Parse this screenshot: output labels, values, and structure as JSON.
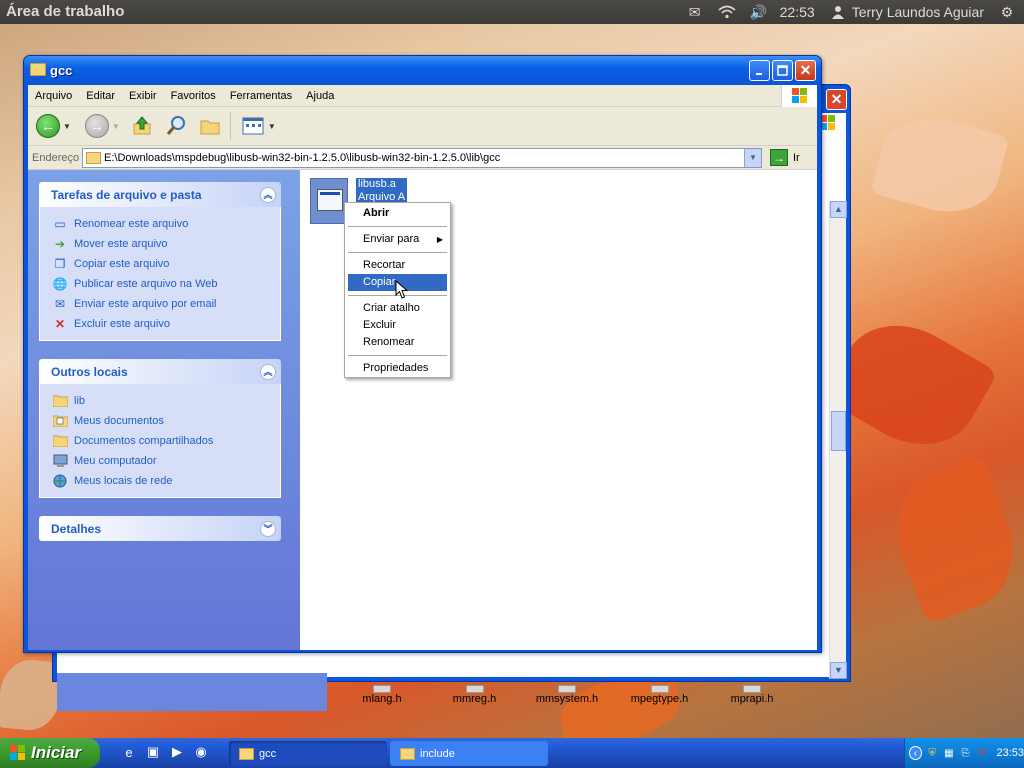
{
  "top_panel": {
    "title": "Área de trabalho",
    "time": "22:53",
    "user": "Terry Laundos Aguiar",
    "icons": [
      "mail-icon",
      "wifi-icon",
      "volume-icon",
      "user-icon",
      "settings-icon"
    ]
  },
  "window": {
    "title": "gcc",
    "menu": [
      "Arquivo",
      "Editar",
      "Exibir",
      "Favoritos",
      "Ferramentas",
      "Ajuda"
    ],
    "address_label": "Endereço",
    "address": "E:\\Downloads\\mspdebug\\libusb-win32-bin-1.2.5.0\\libusb-win32-bin-1.2.5.0\\lib\\gcc",
    "go_label": "Ir"
  },
  "tasks_panel": {
    "title": "Tarefas de arquivo e pasta",
    "items": [
      "Renomear este arquivo",
      "Mover este arquivo",
      "Copiar este arquivo",
      "Publicar este arquivo na Web",
      "Enviar este arquivo por email",
      "Excluir este arquivo"
    ]
  },
  "places_panel": {
    "title": "Outros locais",
    "items": [
      "lib",
      "Meus documentos",
      "Documentos compartilhados",
      "Meu computador",
      "Meus locais de rede"
    ]
  },
  "details_panel": {
    "title": "Detalhes"
  },
  "file": {
    "name": "libusb.a",
    "type": "Arquivo A"
  },
  "context_menu": {
    "items": [
      "Abrir",
      "Enviar para",
      "Recortar",
      "Copiar",
      "Criar atalho",
      "Excluir",
      "Renomear",
      "Propriedades"
    ],
    "selected": "Copiar"
  },
  "back_window": {
    "files": [
      "mlang.h",
      "mmreg.h",
      "mmsystem.h",
      "mpegtype.h",
      "mprapi.h"
    ]
  },
  "taskbar": {
    "start_label": "Iniciar",
    "tasks": [
      "gcc",
      "include"
    ],
    "clock": "23:53"
  }
}
